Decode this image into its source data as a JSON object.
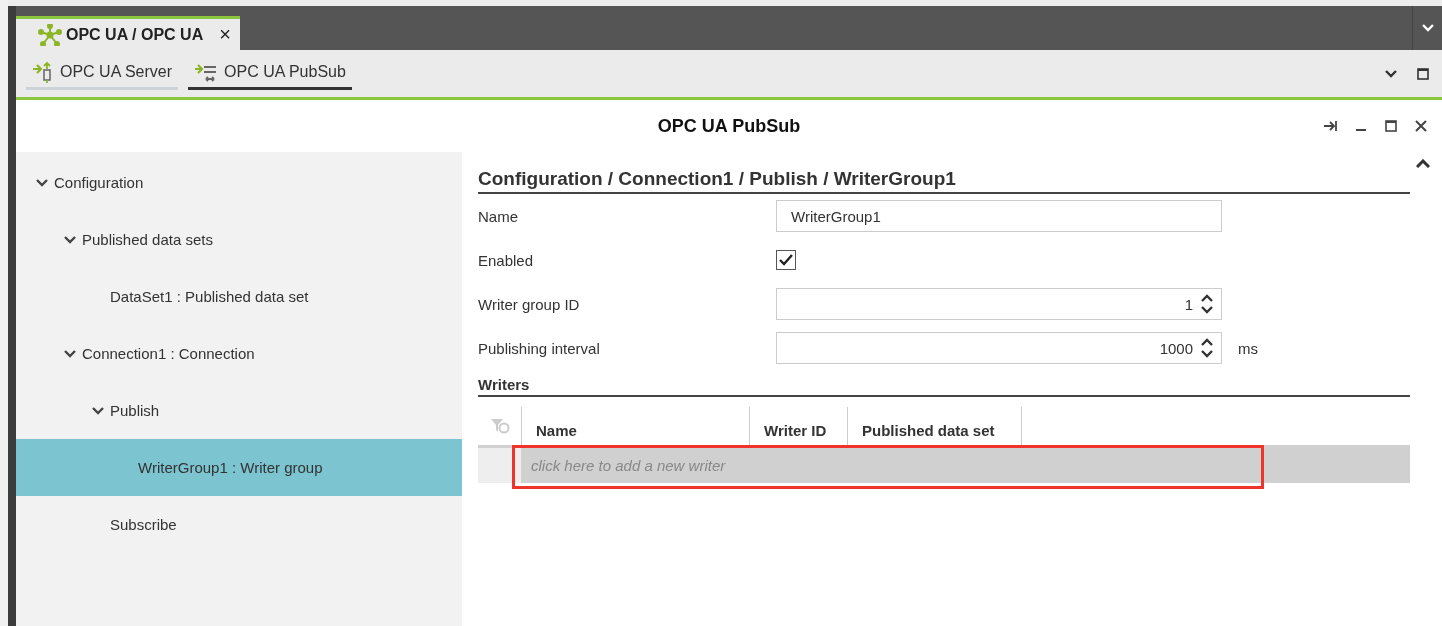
{
  "editor_tab": {
    "title": "OPC UA / OPC UA",
    "close": "×",
    "selected": true
  },
  "sub_tabs": [
    {
      "label": "OPC UA Server",
      "selected": false,
      "kind": "server"
    },
    {
      "label": "OPC UA PubSub",
      "selected": true,
      "kind": "pubsub"
    }
  ],
  "panel": {
    "title": "OPC UA PubSub"
  },
  "tree": [
    {
      "label": "Configuration",
      "expanded": true,
      "selected": false,
      "children": [
        {
          "label": "Published data sets",
          "expanded": true,
          "selected": false,
          "children": [
            {
              "label": "DataSet1 : Published data set",
              "selected": false
            }
          ]
        },
        {
          "label": "Connection1 : Connection",
          "expanded": true,
          "selected": false,
          "children": [
            {
              "label": "Publish",
              "expanded": true,
              "selected": false,
              "children": [
                {
                  "label": "WriterGroup1 : Writer group",
                  "selected": true
                }
              ]
            },
            {
              "label": "Subscribe",
              "selected": false
            }
          ]
        }
      ]
    }
  ],
  "form": {
    "breadcrumb": "Configuration / Connection1 / Publish / WriterGroup1",
    "fields": [
      {
        "label": "Name",
        "kind": "text",
        "value": "WriterGroup1"
      },
      {
        "label": "Enabled",
        "kind": "checkbox",
        "checked": true
      },
      {
        "label": "Writer group ID",
        "kind": "spinner",
        "value": "1"
      },
      {
        "label": "Publishing interval",
        "kind": "spinner",
        "value": "1000",
        "unit": "ms"
      }
    ]
  },
  "writers": {
    "title": "Writers",
    "columns": [
      "Name",
      "Writer ID",
      "Published data set"
    ],
    "new_row_placeholder": "click here to add a new writer"
  }
}
